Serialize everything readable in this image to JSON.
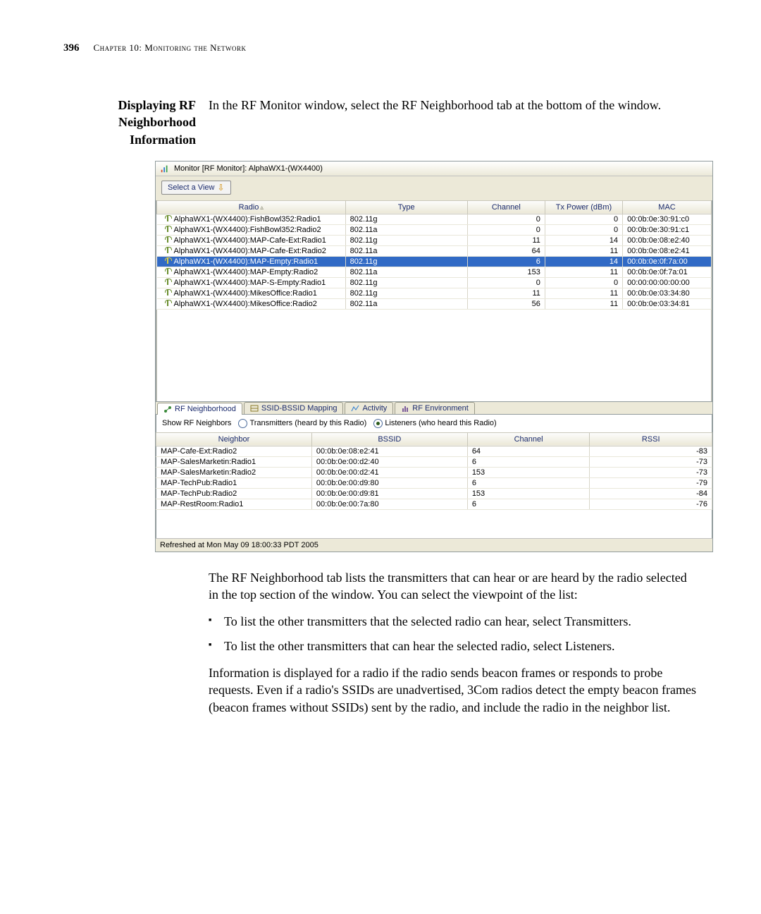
{
  "page": {
    "number": "396",
    "chapter": "Chapter 10: Monitoring the Network"
  },
  "section": {
    "title_l1": "Displaying RF",
    "title_l2": "Neighborhood",
    "title_l3": "Information",
    "intro": "In the RF Monitor window, select the RF Neighborhood tab at the bottom of the window."
  },
  "followup": {
    "p1": "The RF Neighborhood tab lists the transmitters that can hear or are heard by the radio selected in the top section of the window. You can select the viewpoint of the list:",
    "b1": "To list the other transmitters that the selected radio can hear, select Transmitters.",
    "b2": "To list the other transmitters that can hear the selected radio, select Listeners.",
    "p2": "Information is displayed for a radio if the radio sends beacon frames or responds to probe requests. Even if a radio's SSIDs are unadvertised, 3Com radios detect the empty beacon frames (beacon frames without SSIDs) sent by the radio, and include the radio in the neighbor list."
  },
  "ui": {
    "windowTitle": "Monitor [RF Monitor]: AlphaWX1-(WX4400)",
    "selectView": "Select a View",
    "topHeaders": {
      "radio": "Radio",
      "type": "Type",
      "channel": "Channel",
      "txpower": "Tx Power (dBm)",
      "mac": "MAC"
    },
    "topRows": [
      {
        "radio": "AlphaWX1-(WX4400):FishBowl352:Radio1",
        "type": "802.11g",
        "channel": "0",
        "tx": "0",
        "mac": "00:0b:0e:30:91:c0",
        "sel": false
      },
      {
        "radio": "AlphaWX1-(WX4400):FishBowl352:Radio2",
        "type": "802.11a",
        "channel": "0",
        "tx": "0",
        "mac": "00:0b:0e:30:91:c1",
        "sel": false
      },
      {
        "radio": "AlphaWX1-(WX4400):MAP-Cafe-Ext:Radio1",
        "type": "802.11g",
        "channel": "11",
        "tx": "14",
        "mac": "00:0b:0e:08:e2:40",
        "sel": false
      },
      {
        "radio": "AlphaWX1-(WX4400):MAP-Cafe-Ext:Radio2",
        "type": "802.11a",
        "channel": "64",
        "tx": "11",
        "mac": "00:0b:0e:08:e2:41",
        "sel": false
      },
      {
        "radio": "AlphaWX1-(WX4400):MAP-Empty:Radio1",
        "type": "802.11g",
        "channel": "6",
        "tx": "14",
        "mac": "00:0b:0e:0f:7a:00",
        "sel": true
      },
      {
        "radio": "AlphaWX1-(WX4400):MAP-Empty:Radio2",
        "type": "802.11a",
        "channel": "153",
        "tx": "11",
        "mac": "00:0b:0e:0f:7a:01",
        "sel": false
      },
      {
        "radio": "AlphaWX1-(WX4400):MAP-S-Empty:Radio1",
        "type": "802.11g",
        "channel": "0",
        "tx": "0",
        "mac": "00:00:00:00:00:00",
        "sel": false
      },
      {
        "radio": "AlphaWX1-(WX4400):MikesOffice:Radio1",
        "type": "802.11g",
        "channel": "11",
        "tx": "11",
        "mac": "00:0b:0e:03:34:80",
        "sel": false
      },
      {
        "radio": "AlphaWX1-(WX4400):MikesOffice:Radio2",
        "type": "802.11a",
        "channel": "56",
        "tx": "11",
        "mac": "00:0b:0e:03:34:81",
        "sel": false
      }
    ],
    "tabs": {
      "rfn": "RF Neighborhood",
      "ssid": "SSID-BSSID Mapping",
      "act": "Activity",
      "env": "RF Environment"
    },
    "filter": {
      "label": "Show RF Neighbors",
      "optTx": "Transmitters (heard by this Radio)",
      "optLs": "Listeners (who heard this Radio)"
    },
    "nHeaders": {
      "neighbor": "Neighbor",
      "bssid": "BSSID",
      "channel": "Channel",
      "rssi": "RSSI"
    },
    "nRows": [
      {
        "n": "MAP-Cafe-Ext:Radio2",
        "b": "00:0b:0e:08:e2:41",
        "c": "64",
        "r": "-83"
      },
      {
        "n": "MAP-SalesMarketin:Radio1",
        "b": "00:0b:0e:00:d2:40",
        "c": "6",
        "r": "-73"
      },
      {
        "n": "MAP-SalesMarketin:Radio2",
        "b": "00:0b:0e:00:d2:41",
        "c": "153",
        "r": "-73"
      },
      {
        "n": "MAP-TechPub:Radio1",
        "b": "00:0b:0e:00:d9:80",
        "c": "6",
        "r": "-79"
      },
      {
        "n": "MAP-TechPub:Radio2",
        "b": "00:0b:0e:00:d9:81",
        "c": "153",
        "r": "-84"
      },
      {
        "n": "MAP-RestRoom:Radio1",
        "b": "00:0b:0e:00:7a:80",
        "c": "6",
        "r": "-76"
      }
    ],
    "status": "Refreshed at Mon May 09 18:00:33 PDT 2005"
  }
}
